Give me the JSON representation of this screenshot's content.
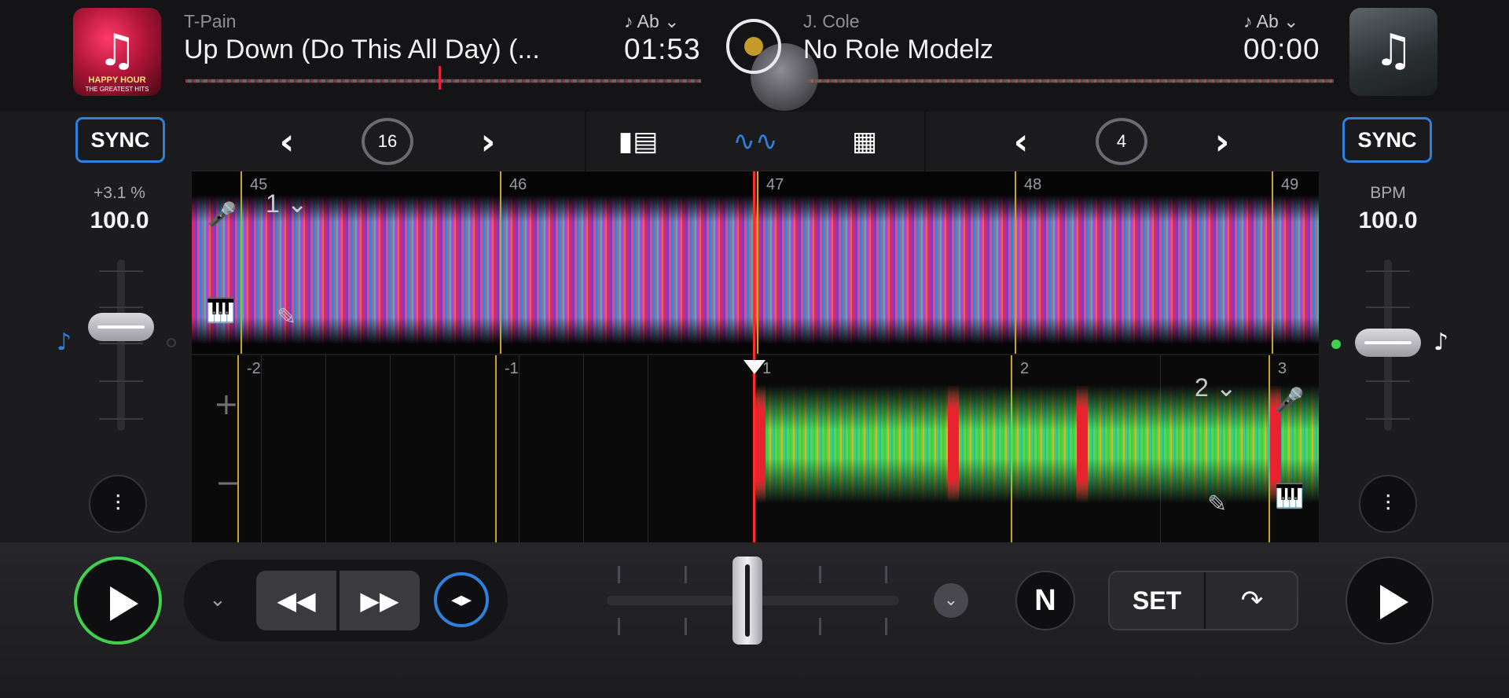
{
  "deck_left": {
    "artist": "T-Pain",
    "title": "Up Down (Do This All Day) (...",
    "key": "♪ Ab ⌄",
    "time": "01:53",
    "art_note": "♫",
    "art_text1": "HAPPY HOUR",
    "art_text2": "THE GREATEST HITS",
    "sync": "SYNC",
    "pitch_pct": "+3.1 %",
    "bpm": "100.0",
    "loop_size": "16",
    "hotcue_slot": "1 ⌄"
  },
  "deck_right": {
    "artist": "J. Cole",
    "title": "No Role Modelz",
    "key": "♪ Ab ⌄",
    "time": "00:00",
    "art_note": "♫",
    "sync": "SYNC",
    "bpm_label": "BPM",
    "bpm": "100.0",
    "loop_size": "4",
    "hotcue_slot": "2 ⌄"
  },
  "waveform_top": {
    "bars": [
      "45",
      "46",
      "47",
      "48",
      "49"
    ]
  },
  "waveform_bottom": {
    "bars": [
      "-2",
      "-1",
      "1",
      "2",
      "3"
    ]
  },
  "controls": {
    "nav_prev": "‹",
    "nav_next": "›",
    "rewind": "◀◀",
    "fast_forward": "▶▶",
    "set": "SET",
    "n_button": "N",
    "eq_icon": "⫶",
    "jump_icon": "↷",
    "sync_lock_icon": "◂▸"
  },
  "colors": {
    "sync_blue": "#2f7fdc",
    "play_green": "#3ed04e",
    "playhead_red": "#ff2a2a",
    "bar_line_gold": "#c8a32a"
  }
}
